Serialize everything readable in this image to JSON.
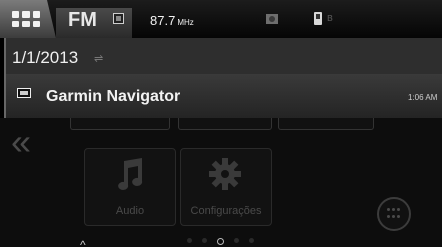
{
  "status_bar": {
    "source": "FM",
    "frequency": "87.7",
    "frequency_unit": "MHz",
    "icons": [
      "home-grid-icon",
      "radio-icon",
      "media-icon",
      "phone-icon",
      "bluetooth-icon"
    ]
  },
  "date_bar": {
    "date": "1/1/2013",
    "icon": "sort-icon"
  },
  "notification": {
    "title": "Garmin Navigator",
    "time": "1:06 AM",
    "icon": "navigator-icon"
  },
  "apps": [
    {
      "label": "Audio",
      "icon": "music-note-icon"
    },
    {
      "label": "Configurações",
      "icon": "gear-icon"
    }
  ],
  "pager": {
    "pages": 5,
    "current": 3
  },
  "colors": {
    "accent": "#ffffff",
    "background": "#000000",
    "dim_text": "#4a4a4a"
  }
}
